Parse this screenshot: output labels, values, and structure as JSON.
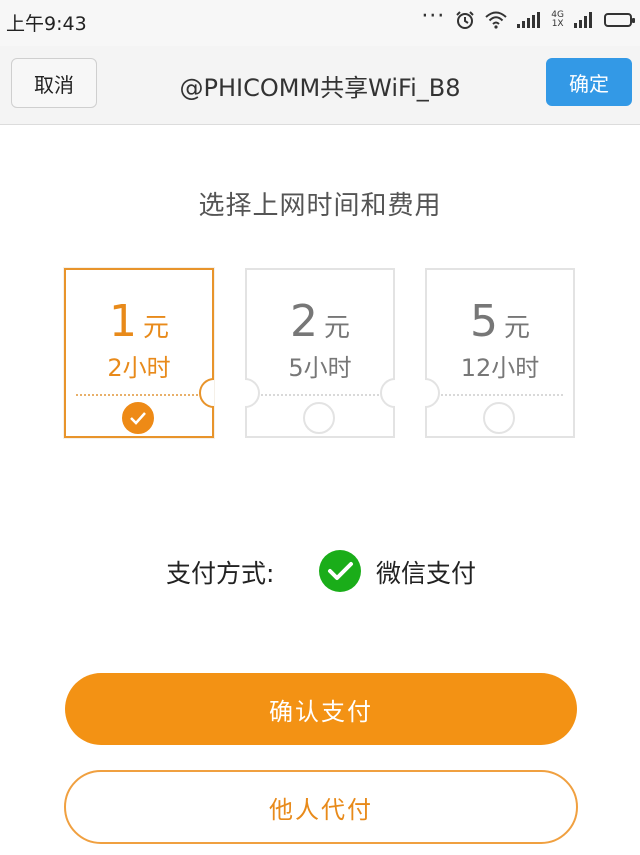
{
  "status_bar": {
    "time": "上午9:43",
    "network": {
      "top": "4G",
      "bottom": "1X"
    },
    "icons": [
      "more-dots-icon",
      "alarm-icon",
      "wifi-icon",
      "signal-icon",
      "battery-icon"
    ]
  },
  "topbar": {
    "cancel_label": "取消",
    "title": "@PHICOMM共享WiFi_B8",
    "confirm_label": "确定"
  },
  "section_title": "选择上网时间和费用",
  "plans": [
    {
      "price": "1",
      "unit": "元",
      "duration": "2小时",
      "selected": true
    },
    {
      "price": "2",
      "unit": "元",
      "duration": "5小时",
      "selected": false
    },
    {
      "price": "5",
      "unit": "元",
      "duration": "12小时",
      "selected": false
    }
  ],
  "payment": {
    "label": "支付方式:",
    "method": "微信支付",
    "method_icon": "wechat-pay-icon"
  },
  "actions": {
    "confirm_pay": "确认支付",
    "pay_for_other": "他人代付"
  },
  "colors": {
    "accent_orange": "#f39214",
    "primary_blue": "#3399e6",
    "wechat_green": "#1aad19"
  }
}
